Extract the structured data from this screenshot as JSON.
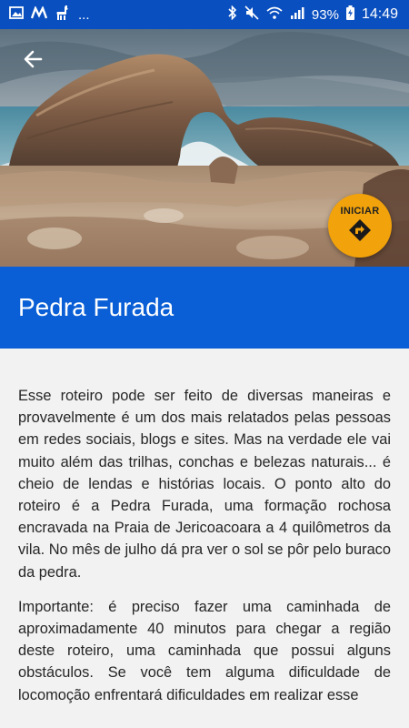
{
  "status_bar": {
    "left_icons": [
      "image-icon",
      "app-m-icon",
      "llama-icon"
    ],
    "more": "...",
    "battery_percent": "93%",
    "time": "14:49"
  },
  "header": {
    "back_icon": "arrow-left-icon"
  },
  "fab": {
    "label": "INICIAR",
    "icon": "directions-icon",
    "color": "#f2a20a"
  },
  "title": "Pedra Furada",
  "colors": {
    "status_bar": "#0a4fbf",
    "title_bar": "#0a5fd6",
    "background": "#f2f2f2"
  },
  "content": {
    "paragraphs": [
      "Esse roteiro pode ser feito de diversas maneiras e provavelmente é um dos mais relatados pelas pessoas em redes sociais, blogs e sites. Mas na verdade ele vai muito além das trilhas, conchas e belezas naturais... é cheio de lendas e histórias locais. O ponto alto do roteiro é a Pedra Furada, uma formação rochosa encravada na Praia de Jericoacoara a 4 quilômetros da vila. No mês de julho dá pra ver o sol se pôr pelo buraco da pedra.",
      "Importante: é preciso fazer uma caminhada de aproximadamente 40 minutos para chegar a região deste roteiro, uma caminhada que possui alguns obstáculos. Se você tem alguma dificuldade de locomoção enfrentará dificuldades em realizar esse"
    ]
  }
}
